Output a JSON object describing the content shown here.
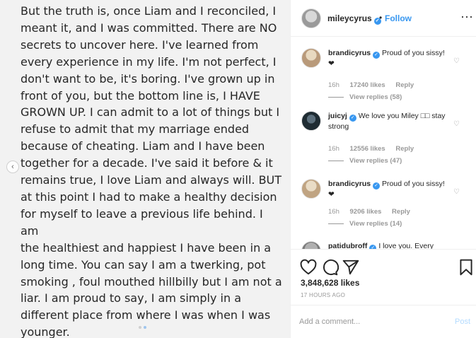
{
  "post": {
    "text": "But the truth is, once Liam and I reconciled, I\nmeant it, and I was committed. There are NO\nsecrets to uncover here. I've learned from\nevery experience in my life. I'm not perfect, I\ndon't want to be, it's boring. I've grown up in\nfront of you, but the bottom line is, I HAVE\nGROWN UP. I can admit to a lot of things but I\nrefuse to admit that my marriage ended\nbecause of cheating. Liam and I have been\ntogether for a decade. I've said it before & it\nremains true, I love Liam and always will. BUT\nat this point I had to make a healthy decision\nfor myself to leave a previous life behind. I am\nthe healthiest and happiest I have been in a\nlong time.  You can say I am a twerking, pot\nsmoking , foul mouthed hillbilly but I am not a\nliar. I am proud to say, I am simply in a\ndifferent place from where I was when I was\nyounger."
  },
  "header": {
    "handle": "mileycyrus",
    "separator": "•",
    "follow_label": "Follow",
    "more_icon": "more-options-icon"
  },
  "comments": [
    {
      "handle": "brandicyrus",
      "verified": true,
      "text": "Proud of you sissy! ❤",
      "time": "16h",
      "likes": "17240 likes",
      "reply": "Reply",
      "view_replies": "View replies (58)"
    },
    {
      "handle": "juicyj",
      "verified": true,
      "text": "We love you Miley □□ stay strong",
      "time": "16h",
      "likes": "12556 likes",
      "reply": "Reply",
      "view_replies": "View replies (47)"
    },
    {
      "handle": "brandicyrus",
      "verified": true,
      "text": "Proud of you sissy! ❤",
      "time": "16h",
      "likes": "9206 likes",
      "reply": "Reply",
      "view_replies": "View replies (14)"
    },
    {
      "handle": "patidubroff",
      "verified": true,
      "text": "I love you. Every",
      "time": "",
      "likes": "",
      "reply": "",
      "view_replies": ""
    }
  ],
  "actions": {
    "likes": "3,848,628 likes",
    "posted": "17 HOURS AGO"
  },
  "add_comment": {
    "placeholder": "Add a comment...",
    "post_label": "Post"
  },
  "colors": {
    "accent": "#3897f0",
    "muted": "#999999",
    "post_disabled": "#b3dbff",
    "image_bg": "#f2f2f2"
  }
}
